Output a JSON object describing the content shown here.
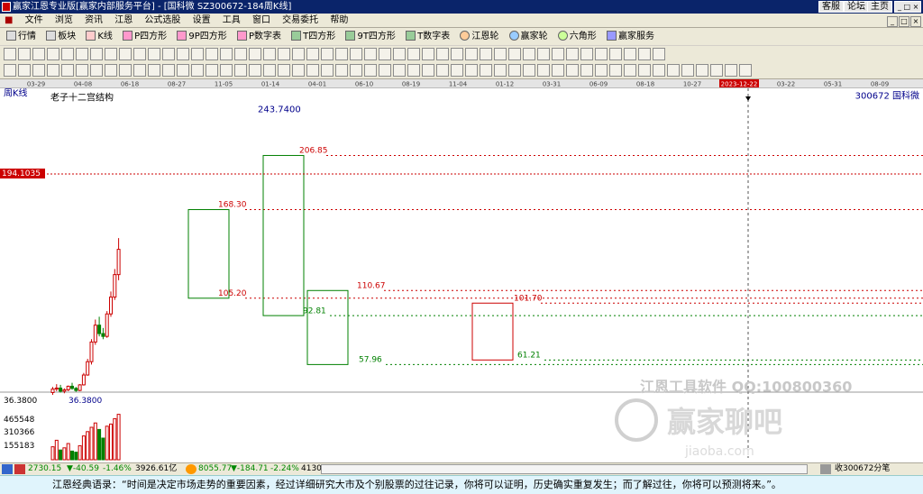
{
  "window": {
    "title": "赢家江恩专业版[赢家内部服务平台] - [国科微  SZ300672-184周K线]",
    "links": [
      "客服",
      "论坛",
      "主页"
    ]
  },
  "menu": [
    "文件",
    "浏览",
    "资讯",
    "江恩",
    "公式选股",
    "设置",
    "工具",
    "窗口",
    "交易委托",
    "帮助"
  ],
  "toolbar1": [
    "行情",
    "板块",
    "K线",
    "P四方形",
    "9P四方形",
    "P数字表",
    "T四方形",
    "9T四方形",
    "T数字表",
    "江恩轮",
    "赢家轮",
    "六角形",
    "赢家服务"
  ],
  "date_axis": [
    "03-29",
    "04-08",
    "06-18",
    "08-27",
    "11-05",
    "01-14",
    "04-01",
    "06-10",
    "08-19",
    "11-04",
    "01-12",
    "03-31",
    "06-09",
    "08-18",
    "10-27",
    "2023-12-22",
    "03-22",
    "05-31",
    "08-09"
  ],
  "chart": {
    "period_label": "周K线",
    "overlay_title": "老子十二宫结构",
    "code_label": "300672  国科微",
    "cursor_price": "194.1035",
    "peak_price": "243.7400",
    "low_price": "36.3800",
    "level_labels": [
      "206.85",
      "168.30",
      "105.20",
      "92.81",
      "110.67",
      "57.96",
      "101.70",
      "61.21"
    ],
    "volume_axis": [
      "465548",
      "310366",
      "155183"
    ],
    "watermark_text": "江恩工具软件  QQ:100800360",
    "watermark_logo": "赢家聊吧",
    "watermark_url": "jiaoba.com"
  },
  "candles": [
    {
      "date": "2017-03-29",
      "o": 38.0,
      "h": 42.0,
      "l": 36.38,
      "c": 40.5
    },
    {
      "date": "2017-04-08",
      "o": 40.5,
      "h": 44.0,
      "l": 39.0,
      "c": 41.2
    },
    {
      "date": "2017-04-15",
      "o": 41.2,
      "h": 43.5,
      "l": 38.0,
      "c": 39.0
    },
    {
      "date": "2017-04-22",
      "o": 39.0,
      "h": 41.0,
      "l": 37.5,
      "c": 40.0
    },
    {
      "date": "2017-04-29",
      "o": 40.0,
      "h": 43.0,
      "l": 39.0,
      "c": 42.5
    },
    {
      "date": "2017-05-06",
      "o": 42.5,
      "h": 45.0,
      "l": 40.0,
      "c": 41.0
    },
    {
      "date": "2017-05-13",
      "o": 41.0,
      "h": 42.0,
      "l": 38.5,
      "c": 39.5
    },
    {
      "date": "2017-05-20",
      "o": 39.5,
      "h": 44.0,
      "l": 39.0,
      "c": 43.5
    },
    {
      "date": "2017-05-27",
      "o": 43.5,
      "h": 52.0,
      "l": 43.0,
      "c": 50.5
    },
    {
      "date": "2017-06-03",
      "o": 50.5,
      "h": 62.0,
      "l": 50.0,
      "c": 60.0
    },
    {
      "date": "2017-06-10",
      "o": 60.0,
      "h": 76.0,
      "l": 58.0,
      "c": 74.0
    },
    {
      "date": "2017-06-18",
      "o": 74.0,
      "h": 90.0,
      "l": 72.0,
      "c": 86.0
    },
    {
      "date": "2017-06-25",
      "o": 86.0,
      "h": 92.0,
      "l": 78.0,
      "c": 80.0
    },
    {
      "date": "2017-07-02",
      "o": 80.0,
      "h": 84.0,
      "l": 76.0,
      "c": 78.0
    },
    {
      "date": "2017-07-09",
      "o": 78.0,
      "h": 96.0,
      "l": 77.0,
      "c": 94.0
    },
    {
      "date": "2017-07-16",
      "o": 94.0,
      "h": 110.0,
      "l": 92.0,
      "c": 106.0
    },
    {
      "date": "2017-07-23",
      "o": 106.0,
      "h": 126.0,
      "l": 104.0,
      "c": 122.0
    },
    {
      "date": "2017-07-30",
      "o": 122.0,
      "h": 148.0,
      "l": 118.0,
      "c": 140.0
    }
  ],
  "volumes": [
    120000,
    180000,
    90000,
    110000,
    150000,
    80000,
    70000,
    130000,
    220000,
    260000,
    300000,
    340000,
    280000,
    200000,
    310000,
    330000,
    380000,
    420000
  ],
  "status": {
    "idx1": "2730.15",
    "chg1": "▼-40.59",
    "pct1": "-1.46%",
    "amt1": "3926.61亿",
    "idx2": "8055.77",
    "chg2": "▼-184.71",
    "pct2": "-2.24%",
    "amt2": "4130.2",
    "right_text": "收300672分笔"
  },
  "quote": "江恩经典语录：“时间是决定市场走势的重要因素，经过详细研究大市及个别股票的过往记录，你将可以证明，历史确实重复发生；而了解过往，你将可以预测将来。”。"
}
